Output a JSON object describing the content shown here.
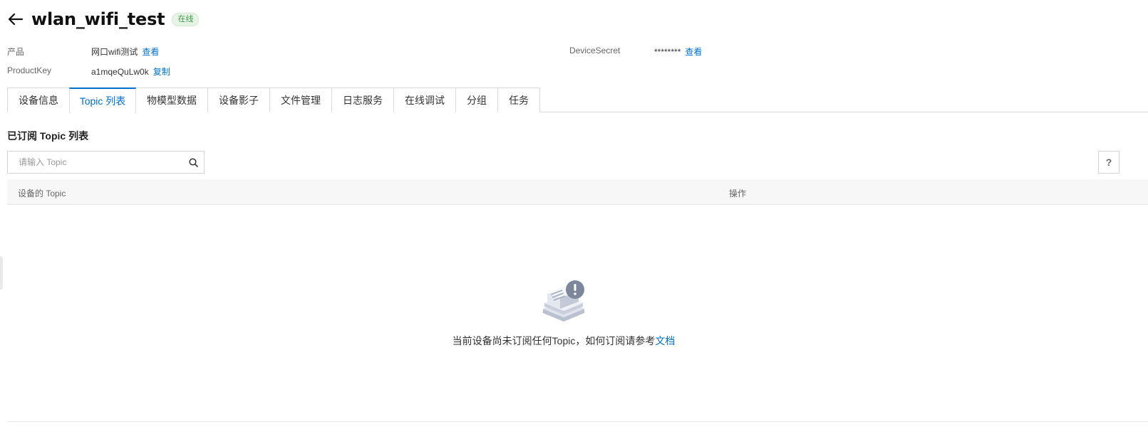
{
  "header": {
    "title": "wlan_wifi_test",
    "status": "在线"
  },
  "info": {
    "product_label": "产品",
    "product_value": "网口wifi测试",
    "product_link": "查看",
    "productkey_label": "ProductKey",
    "productkey_value": "a1mqeQuLw0k",
    "productkey_link": "复制",
    "secret_label": "DeviceSecret",
    "secret_value": "********",
    "secret_link": "查看"
  },
  "tabs": [
    {
      "label": "设备信息"
    },
    {
      "label": "Topic 列表"
    },
    {
      "label": "物模型数据"
    },
    {
      "label": "设备影子"
    },
    {
      "label": "文件管理"
    },
    {
      "label": "日志服务"
    },
    {
      "label": "在线调试"
    },
    {
      "label": "分组"
    },
    {
      "label": "任务"
    }
  ],
  "active_tab": "Topic 列表",
  "section": {
    "title": "已订阅 Topic 列表"
  },
  "search": {
    "placeholder": "请输入 Topic",
    "value": ""
  },
  "help_label": "?",
  "table": {
    "columns": [
      "设备的 Topic",
      "操作"
    ],
    "rows": []
  },
  "empty": {
    "text": "当前设备尚未订阅任何Topic，如何订阅请参考",
    "link": "文档"
  },
  "colors": {
    "accent": "#0070cc",
    "online_badge": "#3f9a4e"
  }
}
